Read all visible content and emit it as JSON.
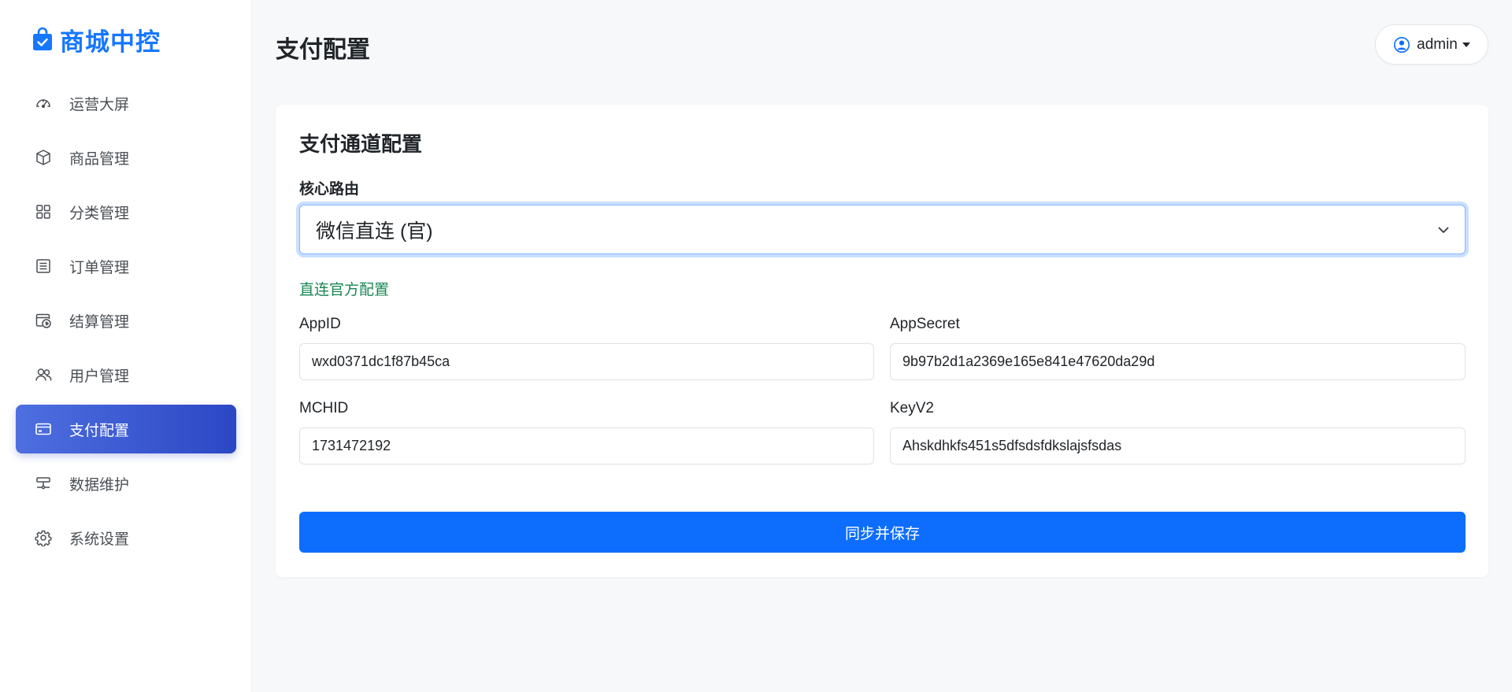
{
  "brand": {
    "name": "商城中控",
    "icon": "shopping-bag-check-icon",
    "color": "#1677ff"
  },
  "sidebar": {
    "items": [
      {
        "label": "运营大屏",
        "icon": "speedometer-icon",
        "active": false
      },
      {
        "label": "商品管理",
        "icon": "box-icon",
        "active": false
      },
      {
        "label": "分类管理",
        "icon": "grid-icon",
        "active": false
      },
      {
        "label": "订单管理",
        "icon": "receipt-icon",
        "active": false
      },
      {
        "label": "结算管理",
        "icon": "cash-calendar-icon",
        "active": false
      },
      {
        "label": "用户管理",
        "icon": "people-icon",
        "active": false
      },
      {
        "label": "支付配置",
        "icon": "credit-card-icon",
        "active": true
      },
      {
        "label": "数据维护",
        "icon": "database-tool-icon",
        "active": false
      },
      {
        "label": "系统设置",
        "icon": "gear-icon",
        "active": false
      }
    ],
    "active_color": "#3a56d4"
  },
  "header": {
    "title": "支付配置",
    "user": {
      "name": "admin",
      "icon": "person-circle-icon"
    }
  },
  "card": {
    "title": "支付通道配置",
    "route": {
      "label": "核心路由",
      "selected": "微信直连 (官)"
    },
    "section_label": "直连官方配置",
    "fields": {
      "appid": {
        "label": "AppID",
        "value": "wxd0371dc1f87b45ca"
      },
      "appsecret": {
        "label": "AppSecret",
        "value": "9b97b2d1a2369e165e841e47620da29d"
      },
      "mchid": {
        "label": "MCHID",
        "value": "1731472192"
      },
      "keyv2": {
        "label": "KeyV2",
        "value": "Ahskdhkfs451s5dfsdsfdkslajsfsdas"
      }
    },
    "save_label": "同步并保存"
  },
  "colors": {
    "primary": "#0d6efd",
    "success_text": "#198754",
    "page_bg": "#f7f8fa"
  }
}
